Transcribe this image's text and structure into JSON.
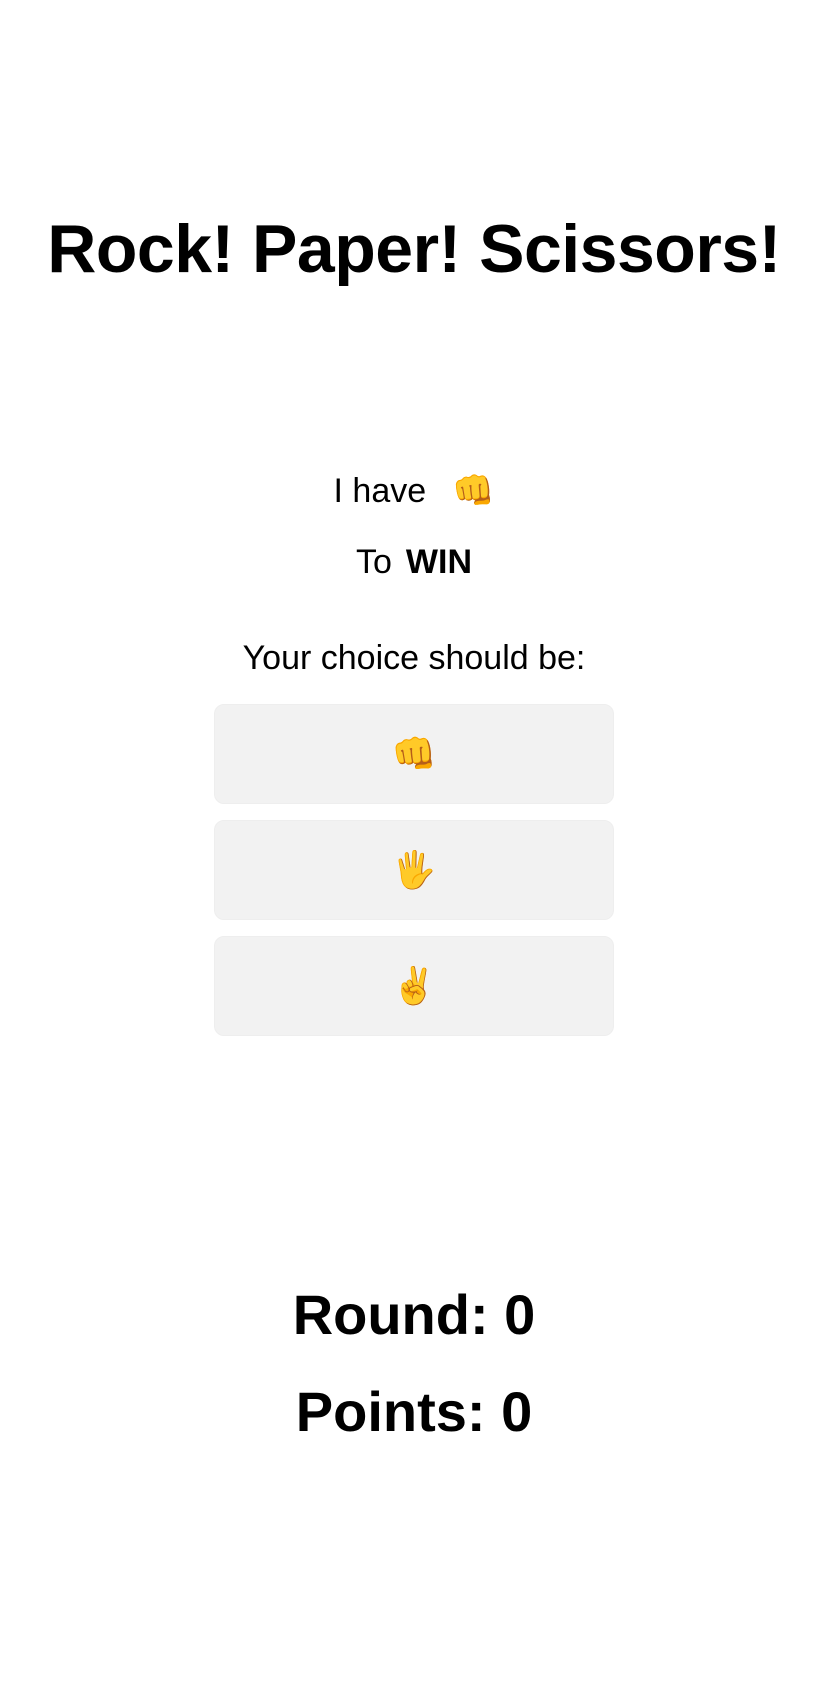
{
  "title": "Rock! Paper! Scissors!",
  "opponent": {
    "prefix": "I have",
    "move": "👊"
  },
  "goal": {
    "prefix": "To",
    "outcome": "WIN"
  },
  "prompt": "Your choice should be:",
  "choices": [
    {
      "label": "👊",
      "icon": "rock-fist-icon"
    },
    {
      "label": "🖐",
      "icon": "paper-hand-icon"
    },
    {
      "label": "✌️",
      "icon": "scissors-victory-icon"
    }
  ],
  "stats": {
    "round": "Round: 0",
    "points": "Points: 0"
  },
  "colors": {
    "background": "#ffffff",
    "button_background": "#f2f2f2",
    "text": "#000000"
  }
}
